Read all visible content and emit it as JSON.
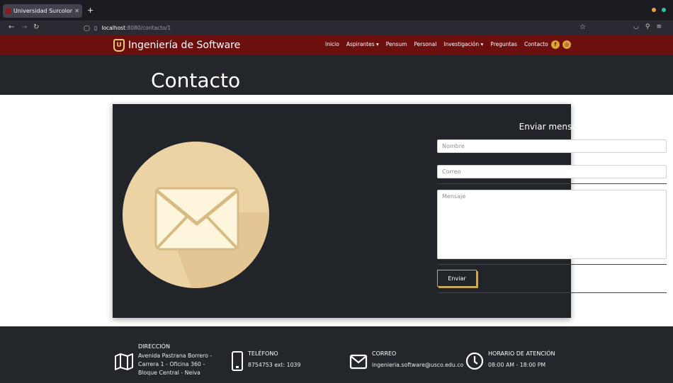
{
  "browser": {
    "tab_title": "Universidad Surcolombian",
    "new_tab": "+",
    "url_host": "localhost",
    "url_path": ":8080/contacto/1",
    "window_dot_colors": [
      "#e8a33d",
      "#2ec4a6"
    ]
  },
  "site": {
    "brand": "Ingeniería de Software",
    "menu": [
      "Inicio",
      "Aspirantes ▾",
      "Pensum",
      "Personal",
      "Investigación ▾",
      "Preguntas",
      "Contacto"
    ],
    "social": [
      "f",
      "◎"
    ],
    "accent_color": "#6b0f0f",
    "gold_color": "#d9a53b"
  },
  "hero": {
    "title": "Contacto"
  },
  "form": {
    "title": "Enviar mensaje",
    "name_placeholder": "Nombre",
    "email_placeholder": "Correo",
    "message_placeholder": "Mensaje",
    "submit_label": "Enviar"
  },
  "footer": {
    "address": {
      "heading": "DIRECCIÓN",
      "lines": [
        "Avenida Pastrana Borrero -",
        "Carrera 1 - Oficina 360 -",
        "Bloque Central - Neiva"
      ],
      "icon": "map-icon"
    },
    "phone": {
      "heading": "TELÉFONO",
      "value": "8754753 ext: 1039",
      "icon": "phone-icon"
    },
    "email": {
      "heading": "CORREO",
      "value": "ingenieria.software@usco.edu.co",
      "icon": "envelope-icon"
    },
    "hours": {
      "heading": "HORARIO DE ATENCIÓN",
      "value": "08:00 AM - 18:00 PM",
      "icon": "clock-icon"
    }
  }
}
